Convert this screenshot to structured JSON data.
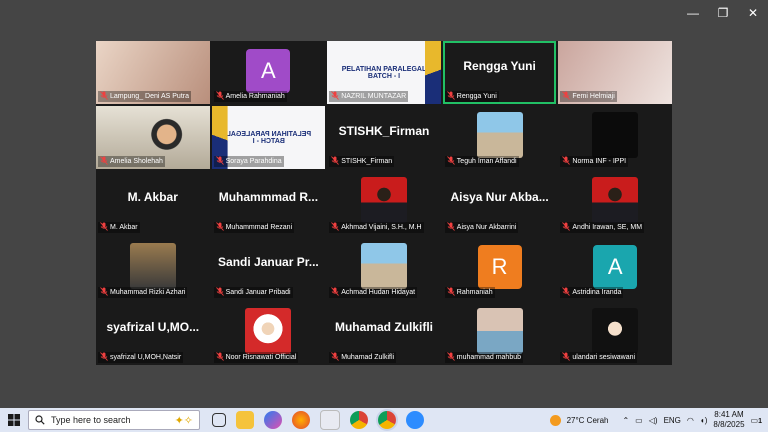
{
  "participants": [
    {
      "name": "Lampung_ Deni AS Putra",
      "kind": "camera",
      "cam": "light"
    },
    {
      "name": "Amelia Rahmaniah",
      "kind": "avatar",
      "letter": "A",
      "color": "#a04bc8"
    },
    {
      "name": "NAZRIL MUNTAZAR",
      "kind": "banner",
      "banner": {
        "line1": "PELATIHAN PARALEGAL",
        "line2": "BATCH - I"
      }
    },
    {
      "name": "Rengga Yuni",
      "kind": "text",
      "big": "Rengga Yuni",
      "active": true
    },
    {
      "name": "Femi Helmiaji",
      "kind": "camera",
      "cam": "pale"
    },
    {
      "name": "Amelia Sholehah",
      "kind": "camera",
      "cam": "person"
    },
    {
      "name": "Soraya Parahdina",
      "kind": "banner",
      "flip": true,
      "banner": {
        "line1": "PELATIHAN PARALEGAL",
        "line2": "BATCH - I"
      }
    },
    {
      "name": "STISHK_Firman",
      "kind": "text",
      "big": "STISHK_Firman"
    },
    {
      "name": "Teguh Iman Affandi",
      "kind": "photo",
      "photo": "beach"
    },
    {
      "name": "Norma INF - IPPI",
      "kind": "photo",
      "photo": "dark"
    },
    {
      "name": "M. Akbar",
      "kind": "text",
      "big": "M. Akbar"
    },
    {
      "name": "Muhammmad Rezani",
      "kind": "text",
      "big": "Muhammmad  R..."
    },
    {
      "name": "Akhmad Vijaini, S.H., M.H",
      "kind": "photo",
      "photo": "formal-red"
    },
    {
      "name": "Aisya Nur Akbarrini",
      "kind": "text",
      "big": "Aisya  Nur  Akba..."
    },
    {
      "name": "Andhi Irawan, SE, MM",
      "kind": "photo",
      "photo": "formal-red"
    },
    {
      "name": "Muhammad Rizki Azhari",
      "kind": "photo",
      "photo": "indoor"
    },
    {
      "name": "Sandi Januar Pribadi",
      "kind": "text",
      "big": "Sandi  Januar  Pr..."
    },
    {
      "name": "Achmad Hudan Hidayat",
      "kind": "photo",
      "photo": "beach"
    },
    {
      "name": "Rahmaniah",
      "kind": "avatar",
      "letter": "R",
      "color": "#ef7d1f"
    },
    {
      "name": "Astridina Iranda",
      "kind": "avatar",
      "letter": "A",
      "color": "#1aa6ae"
    },
    {
      "name": "syafrizal U,MOH,Natsir",
      "kind": "text",
      "big": "syafrizal  U,MO..."
    },
    {
      "name": "Noor Risnawati Official",
      "kind": "photo",
      "photo": "hijab-red"
    },
    {
      "name": "Muhamad Zulkifli",
      "kind": "text",
      "big": "Muhamad Zulkifli"
    },
    {
      "name": "muhammad mahbub",
      "kind": "photo",
      "photo": "sunset"
    },
    {
      "name": "ulandari sesiwawani",
      "kind": "photo",
      "photo": "hijab-dark"
    }
  ],
  "taskbar": {
    "search_placeholder": "Type here to search",
    "weather": "27°C  Cerah",
    "language": "ENG",
    "time": "8:41 AM",
    "date": "8/8/2025",
    "notification_count": "1"
  },
  "window_controls": {
    "minimize": "—",
    "maximize": "❐",
    "close": "✕"
  },
  "colors": {
    "active_speaker": "#21c065",
    "grid_bg": "#1a1a1a",
    "page_bg": "#454545"
  }
}
